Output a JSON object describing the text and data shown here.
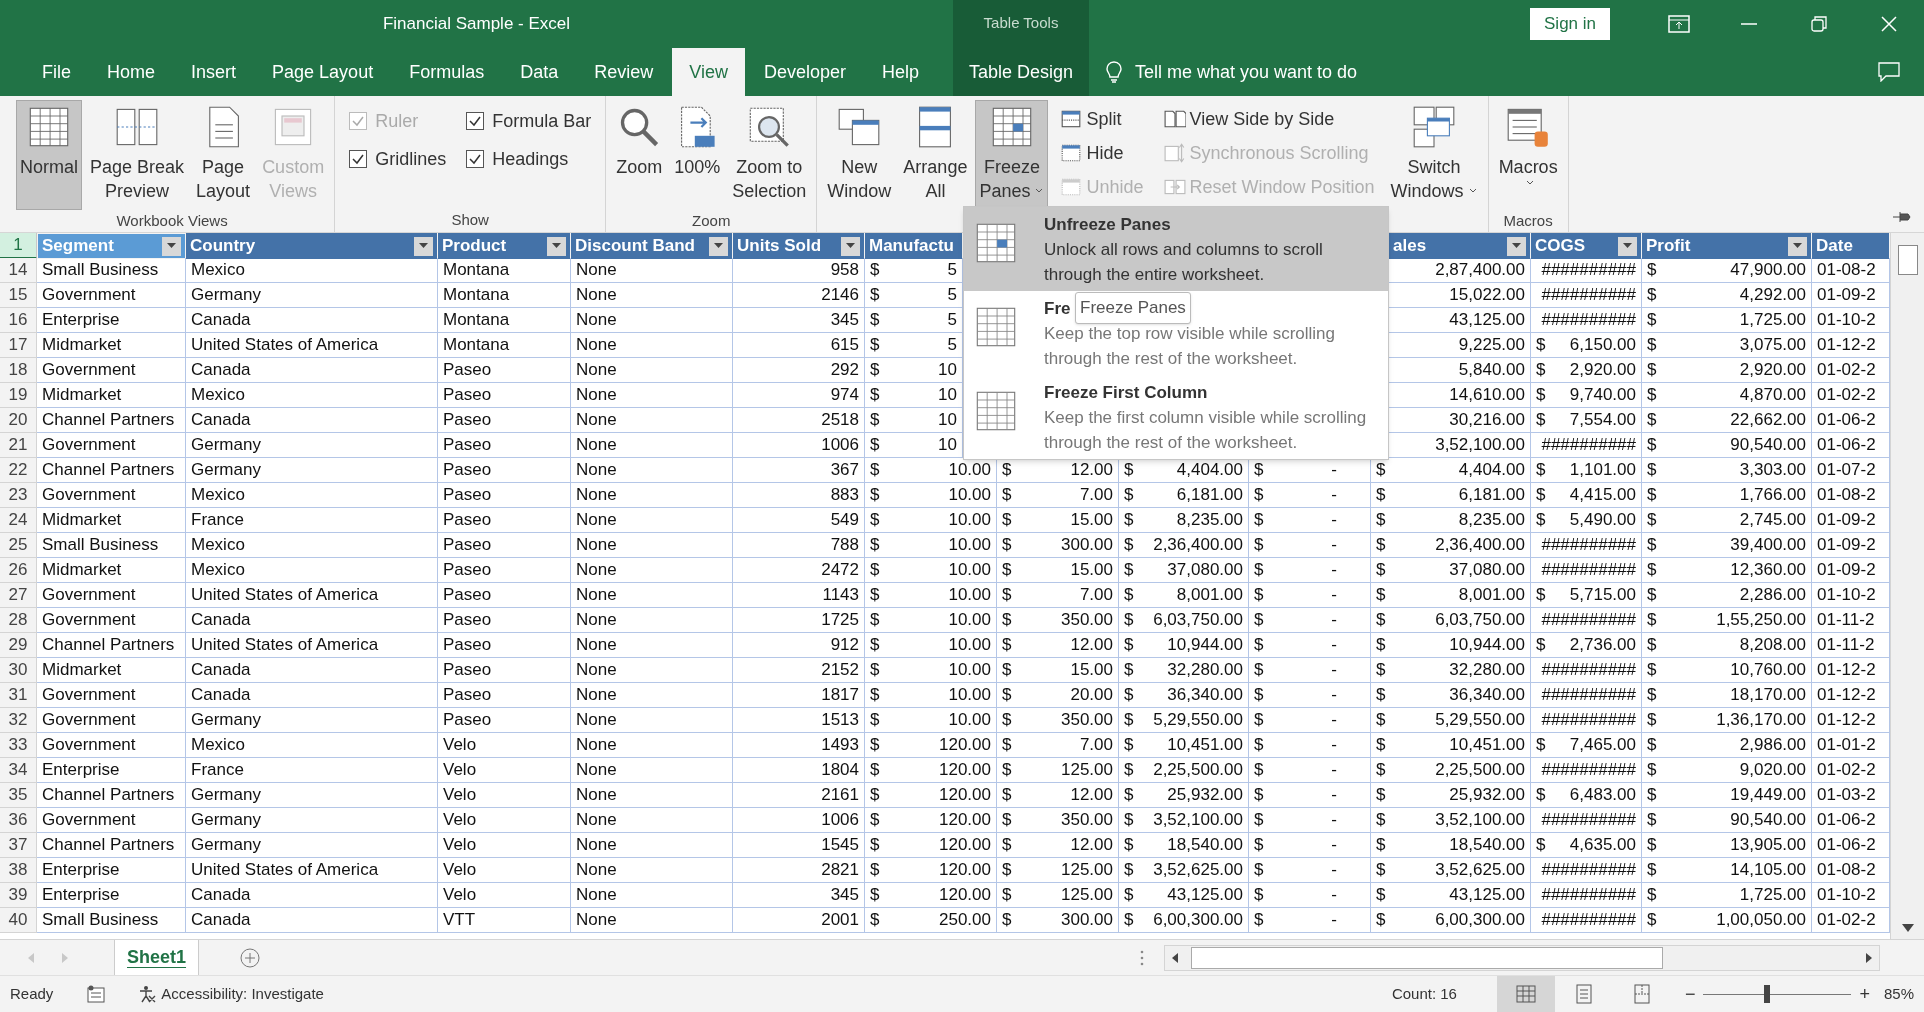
{
  "title_bar": {
    "title": "Financial Sample  -  Excel",
    "context_label": "Table Tools",
    "sign_in": "Sign in"
  },
  "tabs": [
    {
      "label": "File",
      "selected": false,
      "kind": "normal"
    },
    {
      "label": "Home",
      "selected": false,
      "kind": "normal"
    },
    {
      "label": "Insert",
      "selected": false,
      "kind": "normal"
    },
    {
      "label": "Page Layout",
      "selected": false,
      "kind": "normal"
    },
    {
      "label": "Formulas",
      "selected": false,
      "kind": "normal"
    },
    {
      "label": "Data",
      "selected": false,
      "kind": "normal"
    },
    {
      "label": "Review",
      "selected": false,
      "kind": "normal"
    },
    {
      "label": "View",
      "selected": true,
      "kind": "normal"
    },
    {
      "label": "Developer",
      "selected": false,
      "kind": "normal"
    },
    {
      "label": "Help",
      "selected": false,
      "kind": "normal"
    },
    {
      "label": "Table Design",
      "selected": false,
      "kind": "contextual"
    }
  ],
  "search": {
    "placeholder": "Tell me what you want to do"
  },
  "ribbon": {
    "groups": [
      {
        "label": "Workbook Views",
        "columns": [
          [
            {
              "kind": "large",
              "lines": [
                "Normal"
              ],
              "selected": true,
              "disabled": false,
              "dropdown": false
            }
          ],
          [
            {
              "kind": "large",
              "lines": [
                "Page Break",
                "Preview"
              ],
              "selected": false,
              "disabled": false,
              "dropdown": false
            }
          ],
          [
            {
              "kind": "large",
              "lines": [
                "Page",
                "Layout"
              ],
              "selected": false,
              "disabled": false,
              "dropdown": false
            }
          ],
          [
            {
              "kind": "large",
              "lines": [
                "Custom",
                "Views"
              ],
              "selected": false,
              "disabled": true,
              "dropdown": false
            }
          ]
        ]
      },
      {
        "label": "Show",
        "columns": [
          [
            {
              "kind": "checkbox",
              "label": "Ruler",
              "checked": true,
              "disabled": true
            },
            {
              "kind": "checkbox",
              "label": "Gridlines",
              "checked": true,
              "disabled": false
            }
          ],
          [
            {
              "kind": "checkbox",
              "label": "Formula Bar",
              "checked": true,
              "disabled": false
            },
            {
              "kind": "checkbox",
              "label": "Headings",
              "checked": true,
              "disabled": false
            }
          ]
        ]
      },
      {
        "label": "Zoom",
        "columns": [
          [
            {
              "kind": "large",
              "lines": [
                "Zoom"
              ],
              "selected": false,
              "disabled": false,
              "dropdown": false
            }
          ],
          [
            {
              "kind": "large",
              "lines": [
                "100%"
              ],
              "selected": false,
              "disabled": false,
              "dropdown": false
            }
          ],
          [
            {
              "kind": "large",
              "lines": [
                "Zoom to",
                "Selection"
              ],
              "selected": false,
              "disabled": false,
              "dropdown": false
            }
          ]
        ]
      },
      {
        "columns": [
          [
            {
              "kind": "large",
              "lines": [
                "New",
                "Window"
              ],
              "selected": false,
              "disabled": false,
              "dropdown": false
            }
          ],
          [
            {
              "kind": "large",
              "lines": [
                "Arrange",
                "All"
              ],
              "selected": false,
              "disabled": false,
              "dropdown": false
            }
          ],
          [
            {
              "kind": "large",
              "lines": [
                "Freeze",
                "Panes"
              ],
              "selected": true,
              "disabled": false,
              "dropdown": true
            }
          ],
          [
            {
              "kind": "small",
              "label": "Split",
              "disabled": false
            },
            {
              "kind": "small",
              "label": "Hide",
              "disabled": false
            },
            {
              "kind": "small",
              "label": "Unhide",
              "disabled": true
            }
          ],
          [
            {
              "kind": "small",
              "label": "View Side by Side",
              "disabled": false
            },
            {
              "kind": "small",
              "label": "Synchronous Scrolling",
              "disabled": true
            },
            {
              "kind": "small",
              "label": "Reset Window Position",
              "disabled": true
            }
          ],
          [
            {
              "kind": "large",
              "lines": [
                "Switch",
                "Windows"
              ],
              "selected": false,
              "disabled": false,
              "dropdown": true
            }
          ]
        ]
      },
      {
        "label": "Macros",
        "columns": [
          [
            {
              "kind": "large",
              "lines": [
                "Macros"
              ],
              "selected": false,
              "disabled": false,
              "dropdown": true
            }
          ]
        ]
      }
    ]
  },
  "sheet": {
    "header_row": {
      "number": "1",
      "selected": true
    },
    "headers": [
      {
        "label": "Segment",
        "selected": true,
        "filter_button": true
      },
      {
        "label": "Country",
        "selected": false,
        "filter_button": true
      },
      {
        "label": "Product",
        "selected": false,
        "filter_button": true
      },
      {
        "label": "Discount Band",
        "selected": false,
        "filter_button": true
      },
      {
        "label": "Units Sold",
        "selected": false,
        "filter_button": true
      },
      {
        "label": "Manufactu",
        "selected": false,
        "filter_button": false
      },
      {
        "label": "ales",
        "selected": false,
        "filter_button": true
      },
      {
        "label": "COGS",
        "selected": false,
        "filter_button": true
      },
      {
        "label": "Profit",
        "selected": false,
        "filter_button": true
      },
      {
        "label": "Date",
        "selected": false,
        "filter_button": false
      }
    ],
    "rows": [
      {
        "number": "14",
        "cells": [
          "Small Business",
          "Mexico",
          "Montana",
          "None",
          "958",
          [
            "$",
            "5"
          ],
          "2,87,400.00",
          "##########",
          [
            "$",
            "47,900.00"
          ],
          "01-08-2"
        ]
      },
      {
        "number": "15",
        "cells": [
          "Government",
          "Germany",
          "Montana",
          "None",
          "2146",
          [
            "$",
            "5"
          ],
          "15,022.00",
          "##########",
          [
            "$",
            "4,292.00"
          ],
          "01-09-2"
        ]
      },
      {
        "number": "16",
        "cells": [
          "Enterprise",
          "Canada",
          "Montana",
          "None",
          "345",
          [
            "$",
            "5"
          ],
          "43,125.00",
          "##########",
          [
            "$",
            "1,725.00"
          ],
          "01-10-2"
        ]
      },
      {
        "number": "17",
        "cells": [
          "Midmarket",
          "United States of America",
          "Montana",
          "None",
          "615",
          [
            "$",
            "5"
          ],
          "9,225.00",
          [
            "$",
            "6,150.00"
          ],
          [
            "$",
            "3,075.00"
          ],
          "01-12-2"
        ]
      },
      {
        "number": "18",
        "cells": [
          "Government",
          "Canada",
          "Paseo",
          "None",
          "292",
          [
            "$",
            "10"
          ],
          "5,840.00",
          [
            "$",
            "2,920.00"
          ],
          [
            "$",
            "2,920.00"
          ],
          "01-02-2"
        ]
      },
      {
        "number": "19",
        "cells": [
          "Midmarket",
          "Mexico",
          "Paseo",
          "None",
          "974",
          [
            "$",
            "10"
          ],
          "14,610.00",
          [
            "$",
            "9,740.00"
          ],
          [
            "$",
            "4,870.00"
          ],
          "01-02-2"
        ]
      },
      {
        "number": "20",
        "cells": [
          "Channel Partners",
          "Canada",
          "Paseo",
          "None",
          "2518",
          [
            "$",
            "10"
          ],
          "30,216.00",
          [
            "$",
            "7,554.00"
          ],
          [
            "$",
            "22,662.00"
          ],
          "01-06-2"
        ]
      },
      {
        "number": "21",
        "cells": [
          "Government",
          "Germany",
          "Paseo",
          "None",
          "1006",
          [
            "$",
            "10"
          ],
          "3,52,100.00",
          "##########",
          [
            "$",
            "90,540.00"
          ],
          "01-06-2"
        ]
      },
      {
        "number": "22",
        "cells": [
          "Channel Partners",
          "Germany",
          "Paseo",
          "None",
          "367",
          [
            "$",
            "10.00"
          ],
          [
            "$",
            "12.00"
          ],
          [
            "$",
            "4,404.00"
          ],
          [
            "$",
            "-"
          ],
          [
            "$",
            "4,404.00"
          ],
          [
            "$",
            "1,101.00"
          ],
          [
            "$",
            "3,303.00"
          ],
          "01-07-2"
        ]
      },
      {
        "number": "23",
        "cells": [
          "Government",
          "Mexico",
          "Paseo",
          "None",
          "883",
          [
            "$",
            "10.00"
          ],
          [
            "$",
            "7.00"
          ],
          [
            "$",
            "6,181.00"
          ],
          [
            "$",
            "-"
          ],
          [
            "$",
            "6,181.00"
          ],
          [
            "$",
            "4,415.00"
          ],
          [
            "$",
            "1,766.00"
          ],
          "01-08-2"
        ]
      },
      {
        "number": "24",
        "cells": [
          "Midmarket",
          "France",
          "Paseo",
          "None",
          "549",
          [
            "$",
            "10.00"
          ],
          [
            "$",
            "15.00"
          ],
          [
            "$",
            "8,235.00"
          ],
          [
            "$",
            "-"
          ],
          [
            "$",
            "8,235.00"
          ],
          [
            "$",
            "5,490.00"
          ],
          [
            "$",
            "2,745.00"
          ],
          "01-09-2"
        ]
      },
      {
        "number": "25",
        "cells": [
          "Small Business",
          "Mexico",
          "Paseo",
          "None",
          "788",
          [
            "$",
            "10.00"
          ],
          [
            "$",
            "300.00"
          ],
          [
            "$",
            "2,36,400.00"
          ],
          [
            "$",
            "-"
          ],
          [
            "$",
            "2,36,400.00"
          ],
          "##########",
          [
            "$",
            "39,400.00"
          ],
          "01-09-2"
        ]
      },
      {
        "number": "26",
        "cells": [
          "Midmarket",
          "Mexico",
          "Paseo",
          "None",
          "2472",
          [
            "$",
            "10.00"
          ],
          [
            "$",
            "15.00"
          ],
          [
            "$",
            "37,080.00"
          ],
          [
            "$",
            "-"
          ],
          [
            "$",
            "37,080.00"
          ],
          "##########",
          [
            "$",
            "12,360.00"
          ],
          "01-09-2"
        ]
      },
      {
        "number": "27",
        "cells": [
          "Government",
          "United States of America",
          "Paseo",
          "None",
          "1143",
          [
            "$",
            "10.00"
          ],
          [
            "$",
            "7.00"
          ],
          [
            "$",
            "8,001.00"
          ],
          [
            "$",
            "-"
          ],
          [
            "$",
            "8,001.00"
          ],
          [
            "$",
            "5,715.00"
          ],
          [
            "$",
            "2,286.00"
          ],
          "01-10-2"
        ]
      },
      {
        "number": "28",
        "cells": [
          "Government",
          "Canada",
          "Paseo",
          "None",
          "1725",
          [
            "$",
            "10.00"
          ],
          [
            "$",
            "350.00"
          ],
          [
            "$",
            "6,03,750.00"
          ],
          [
            "$",
            "-"
          ],
          [
            "$",
            "6,03,750.00"
          ],
          "##########",
          [
            "$",
            "1,55,250.00"
          ],
          "01-11-2"
        ]
      },
      {
        "number": "29",
        "cells": [
          "Channel Partners",
          "United States of America",
          "Paseo",
          "None",
          "912",
          [
            "$",
            "10.00"
          ],
          [
            "$",
            "12.00"
          ],
          [
            "$",
            "10,944.00"
          ],
          [
            "$",
            "-"
          ],
          [
            "$",
            "10,944.00"
          ],
          [
            "$",
            "2,736.00"
          ],
          [
            "$",
            "8,208.00"
          ],
          "01-11-2"
        ]
      },
      {
        "number": "30",
        "cells": [
          "Midmarket",
          "Canada",
          "Paseo",
          "None",
          "2152",
          [
            "$",
            "10.00"
          ],
          [
            "$",
            "15.00"
          ],
          [
            "$",
            "32,280.00"
          ],
          [
            "$",
            "-"
          ],
          [
            "$",
            "32,280.00"
          ],
          "##########",
          [
            "$",
            "10,760.00"
          ],
          "01-12-2"
        ]
      },
      {
        "number": "31",
        "cells": [
          "Government",
          "Canada",
          "Paseo",
          "None",
          "1817",
          [
            "$",
            "10.00"
          ],
          [
            "$",
            "20.00"
          ],
          [
            "$",
            "36,340.00"
          ],
          [
            "$",
            "-"
          ],
          [
            "$",
            "36,340.00"
          ],
          "##########",
          [
            "$",
            "18,170.00"
          ],
          "01-12-2"
        ]
      },
      {
        "number": "32",
        "cells": [
          "Government",
          "Germany",
          "Paseo",
          "None",
          "1513",
          [
            "$",
            "10.00"
          ],
          [
            "$",
            "350.00"
          ],
          [
            "$",
            "5,29,550.00"
          ],
          [
            "$",
            "-"
          ],
          [
            "$",
            "5,29,550.00"
          ],
          "##########",
          [
            "$",
            "1,36,170.00"
          ],
          "01-12-2"
        ]
      },
      {
        "number": "33",
        "cells": [
          "Government",
          "Mexico",
          "Velo",
          "None",
          "1493",
          [
            "$",
            "120.00"
          ],
          [
            "$",
            "7.00"
          ],
          [
            "$",
            "10,451.00"
          ],
          [
            "$",
            "-"
          ],
          [
            "$",
            "10,451.00"
          ],
          [
            "$",
            "7,465.00"
          ],
          [
            "$",
            "2,986.00"
          ],
          "01-01-2"
        ]
      },
      {
        "number": "34",
        "cells": [
          "Enterprise",
          "France",
          "Velo",
          "None",
          "1804",
          [
            "$",
            "120.00"
          ],
          [
            "$",
            "125.00"
          ],
          [
            "$",
            "2,25,500.00"
          ],
          [
            "$",
            "-"
          ],
          [
            "$",
            "2,25,500.00"
          ],
          "##########",
          [
            "$",
            "9,020.00"
          ],
          "01-02-2"
        ]
      },
      {
        "number": "35",
        "cells": [
          "Channel Partners",
          "Germany",
          "Velo",
          "None",
          "2161",
          [
            "$",
            "120.00"
          ],
          [
            "$",
            "12.00"
          ],
          [
            "$",
            "25,932.00"
          ],
          [
            "$",
            "-"
          ],
          [
            "$",
            "25,932.00"
          ],
          [
            "$",
            "6,483.00"
          ],
          [
            "$",
            "19,449.00"
          ],
          "01-03-2"
        ]
      },
      {
        "number": "36",
        "cells": [
          "Government",
          "Germany",
          "Velo",
          "None",
          "1006",
          [
            "$",
            "120.00"
          ],
          [
            "$",
            "350.00"
          ],
          [
            "$",
            "3,52,100.00"
          ],
          [
            "$",
            "-"
          ],
          [
            "$",
            "3,52,100.00"
          ],
          "##########",
          [
            "$",
            "90,540.00"
          ],
          "01-06-2"
        ]
      },
      {
        "number": "37",
        "cells": [
          "Channel Partners",
          "Germany",
          "Velo",
          "None",
          "1545",
          [
            "$",
            "120.00"
          ],
          [
            "$",
            "12.00"
          ],
          [
            "$",
            "18,540.00"
          ],
          [
            "$",
            "-"
          ],
          [
            "$",
            "18,540.00"
          ],
          [
            "$",
            "4,635.00"
          ],
          [
            "$",
            "13,905.00"
          ],
          "01-06-2"
        ]
      },
      {
        "number": "38",
        "cells": [
          "Enterprise",
          "United States of America",
          "Velo",
          "None",
          "2821",
          [
            "$",
            "120.00"
          ],
          [
            "$",
            "125.00"
          ],
          [
            "$",
            "3,52,625.00"
          ],
          [
            "$",
            "-"
          ],
          [
            "$",
            "3,52,625.00"
          ],
          "##########",
          [
            "$",
            "14,105.00"
          ],
          "01-08-2"
        ]
      },
      {
        "number": "39",
        "cells": [
          "Enterprise",
          "Canada",
          "Velo",
          "None",
          "345",
          [
            "$",
            "120.00"
          ],
          [
            "$",
            "125.00"
          ],
          [
            "$",
            "43,125.00"
          ],
          [
            "$",
            "-"
          ],
          [
            "$",
            "43,125.00"
          ],
          "##########",
          [
            "$",
            "1,725.00"
          ],
          "01-10-2"
        ]
      },
      {
        "number": "40",
        "cells": [
          "Small Business",
          "Canada",
          "VTT",
          "None",
          "2001",
          [
            "$",
            "250.00"
          ],
          [
            "$",
            "300.00"
          ],
          [
            "$",
            "6,00,300.00"
          ],
          [
            "$",
            "-"
          ],
          [
            "$",
            "6,00,300.00"
          ],
          "##########",
          [
            "$",
            "1,00,050.00"
          ],
          "01-02-2"
        ]
      }
    ]
  },
  "freeze_menu": {
    "items": [
      {
        "title": "Unfreeze Panes",
        "description": "Unlock all rows and columns to scroll through the entire worksheet.",
        "selected": true
      },
      {
        "title": "Fre",
        "description": "Keep the top row visible while scrolling through the rest of the worksheet.",
        "selected": false
      },
      {
        "title": "Freeze First Column",
        "description": "Keep the first column visible while scrolling through the rest of the worksheet.",
        "selected": false
      }
    ],
    "tooltip": "Freeze Panes"
  },
  "sheet_tabs": [
    {
      "label": "Sheet1",
      "selected": true
    }
  ],
  "status_bar": {
    "ready": "Ready",
    "accessibility": "Accessibility: Investigate",
    "count": "Count: 16",
    "views": [
      {
        "selected": true
      },
      {
        "selected": false
      },
      {
        "selected": false
      }
    ],
    "zoom_out": "−",
    "zoom_in": "+",
    "zoom": {
      "level": 0.43,
      "reading": "85%"
    }
  }
}
